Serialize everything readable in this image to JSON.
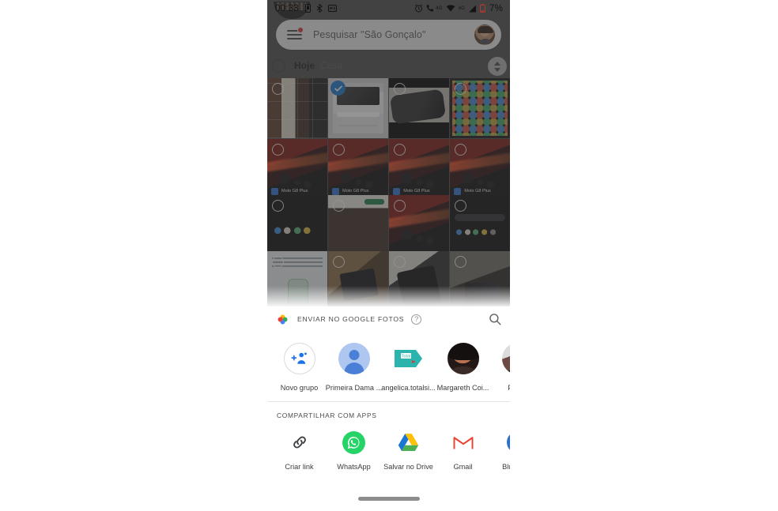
{
  "statusbar": {
    "clock": "00:33",
    "battery_percent": "7%",
    "network_label": "4G",
    "call_label": "4G",
    "icons": [
      "alarm-icon",
      "sim-icon",
      "bluetooth-share-icon",
      "sms-icon",
      "call-forward-icon",
      "wifi-icon",
      "signal-icon",
      "battery-icon"
    ]
  },
  "search": {
    "placeholder": "Pesquisar \"São Gonçalo\"",
    "menu_icon": "hamburger-menu-icon",
    "badge": "notification-dot",
    "avatar": "account-avatar"
  },
  "section": {
    "today_label": "Hoje",
    "place_label": "Casa",
    "select_circle": "selection-circle",
    "scrubber": "scroll-scrubber"
  },
  "grid": {
    "photos": [
      {
        "id": "p1",
        "art": "t-collage",
        "selected": false,
        "caption": ""
      },
      {
        "id": "p2",
        "art": "t-screenshot",
        "selected": true,
        "caption": ""
      },
      {
        "id": "p3",
        "art": "t-device",
        "selected": false,
        "caption": ""
      },
      {
        "id": "p4",
        "art": "t-appgrid",
        "selected": false,
        "caption": ""
      },
      {
        "id": "p5",
        "art": "t-car",
        "selected": false,
        "caption": "Moto G8 Plus"
      },
      {
        "id": "p6",
        "art": "t-car",
        "selected": false,
        "caption": "Moto G8 Plus"
      },
      {
        "id": "p7",
        "art": "t-car",
        "selected": false,
        "caption": "Moto G8 Plus"
      },
      {
        "id": "p8",
        "art": "t-car",
        "selected": false,
        "caption": "Moto G8 Plus"
      },
      {
        "id": "p9",
        "art": "t-dark-home",
        "selected": false,
        "caption": ""
      },
      {
        "id": "p10",
        "art": "t-chat",
        "selected": false,
        "caption": ""
      },
      {
        "id": "p11",
        "art": "t-car",
        "selected": false,
        "caption": ""
      },
      {
        "id": "p12",
        "art": "t-settings",
        "selected": false,
        "caption": ""
      },
      {
        "id": "p13",
        "art": "t-news",
        "selected": false,
        "caption": ""
      },
      {
        "id": "p14",
        "art": "t-hands",
        "selected": false,
        "caption": ""
      },
      {
        "id": "p15",
        "art": "t-phoneblack",
        "selected": false,
        "caption": ""
      },
      {
        "id": "p16",
        "art": "t-card",
        "selected": false,
        "caption": ""
      }
    ]
  },
  "sheet": {
    "title": "ENVIAR NO GOOGLE FOTOS",
    "help_glyph": "?",
    "logo_icon": "google-photos-icon",
    "search_icon": "search-icon",
    "contacts": [
      {
        "name": "Novo grupo",
        "avatar": "av-newgroup",
        "icon": "add-group-icon"
      },
      {
        "name": "Primeira Dama ...",
        "avatar": "av-person",
        "icon": "person-placeholder-icon"
      },
      {
        "name": "angelica.totalsi...",
        "avatar": "av-total",
        "icon": "total-play-icon"
      },
      {
        "name": "Margareth Coi...",
        "avatar": "av-photo1",
        "icon": "contact-photo"
      },
      {
        "name": "Pedro",
        "avatar": "av-photo2",
        "icon": "contact-photo"
      }
    ],
    "apps_label": "COMPARTILHAR COM APPS",
    "apps": [
      {
        "name": "Criar link",
        "icon": "link-icon"
      },
      {
        "name": "WhatsApp",
        "icon": "whatsapp-icon"
      },
      {
        "name": "Salvar no Drive",
        "icon": "google-drive-icon"
      },
      {
        "name": "Gmail",
        "icon": "gmail-icon"
      },
      {
        "name": "Bluetooth",
        "icon": "bluetooth-icon"
      }
    ],
    "home_indicator": "home-gesture-bar"
  },
  "colors": {
    "accent_blue": "#1a73c8",
    "whatsapp_green": "#25D366",
    "bluetooth_blue": "#2a6fd4",
    "gmail_red": "#EA4335",
    "badge_red": "#d8342b",
    "sheet_bg": "#ffffff",
    "scrim": "rgba(60,60,60,0.55)"
  }
}
